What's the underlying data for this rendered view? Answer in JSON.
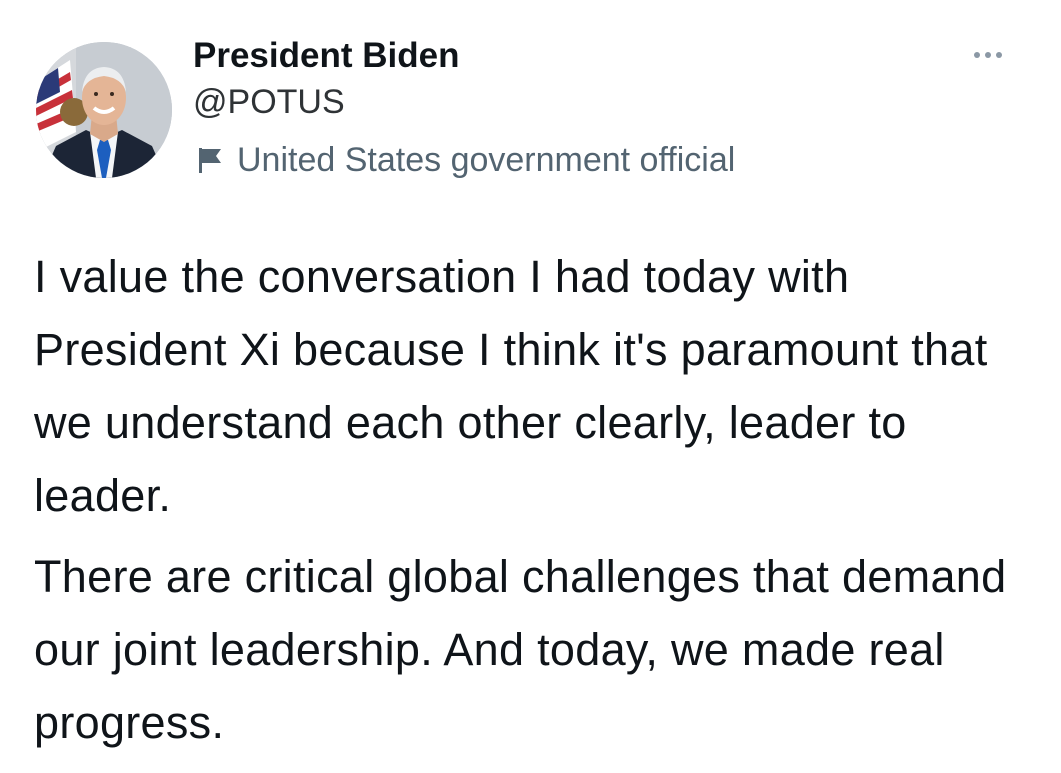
{
  "tweet": {
    "author": {
      "display_name": "President Biden",
      "handle": "@POTUS",
      "label": "United States government official",
      "avatar_icon": "portrait-avatar",
      "label_icon": "flag-icon"
    },
    "more_icon": "more-options-icon",
    "paragraphs": [
      "I value the conversation I had today with President Xi because I think it's paramount that we understand each other clearly, leader to leader.",
      "There are critical global challenges that demand our joint leadership. And today, we made real progress."
    ],
    "colors": {
      "text_primary": "#0f1419",
      "text_secondary": "#536471",
      "tie_blue": "#1d5fbf"
    }
  }
}
